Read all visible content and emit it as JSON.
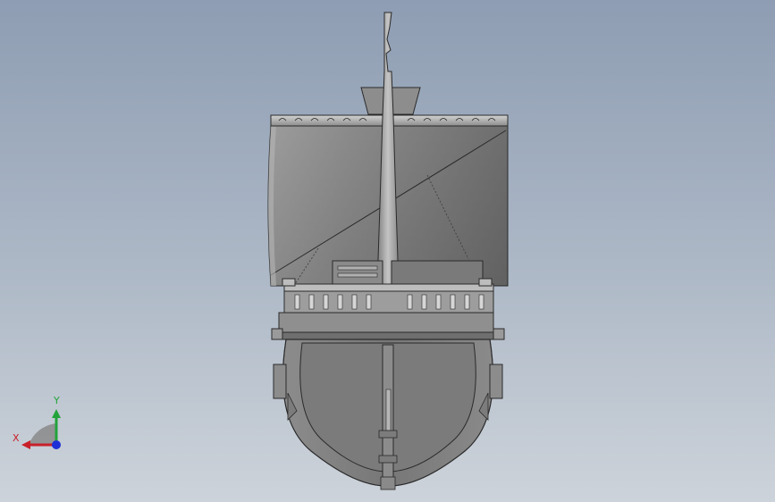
{
  "viewport": {
    "background_top": "#8e9db3",
    "background_bottom": "#cdd3da",
    "model_fill": "#7a7a7a",
    "model_fill_light": "#a9a9a9",
    "model_edge": "#2a2a2a"
  },
  "triad": {
    "x_label": "X",
    "y_label": "Y",
    "x_color": "#c8202a",
    "y_color": "#22a33a",
    "z_color": "#1d2fd6"
  }
}
